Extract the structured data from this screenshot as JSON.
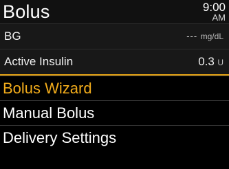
{
  "header": {
    "title": "Bolus",
    "time": "9:00",
    "ampm": "AM"
  },
  "info": [
    {
      "label": "BG",
      "value": "---",
      "unit": "mg/dL"
    },
    {
      "label": "Active Insulin",
      "value": "0.3",
      "unit": "U"
    }
  ],
  "menu": {
    "items": [
      {
        "label": "Bolus Wizard",
        "selected": true
      },
      {
        "label": "Manual Bolus",
        "selected": false
      },
      {
        "label": "Delivery Settings",
        "selected": false
      }
    ]
  },
  "colors": {
    "background": "#000000",
    "highlight": "#f2ac1b",
    "text": "#ffffff"
  }
}
